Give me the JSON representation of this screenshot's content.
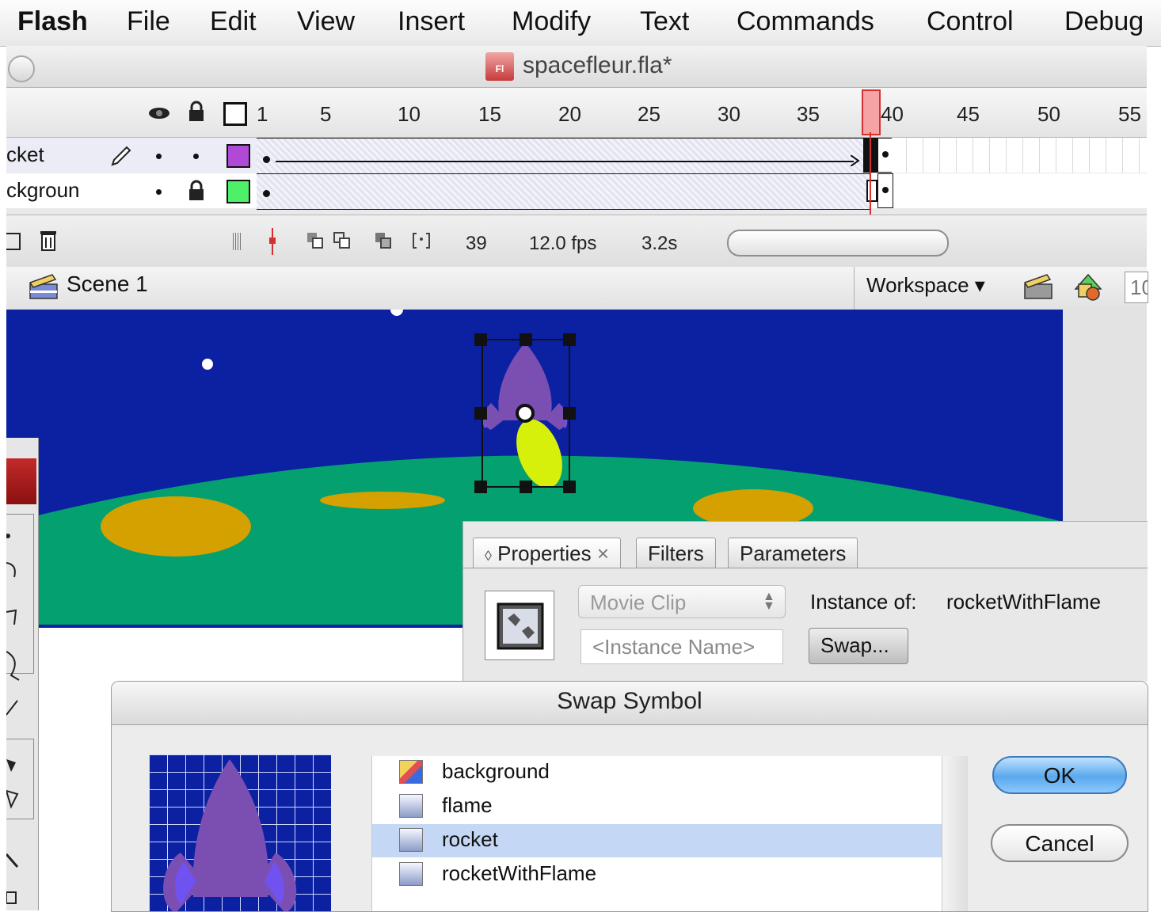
{
  "menubar": {
    "items": [
      "Flash",
      "File",
      "Edit",
      "View",
      "Insert",
      "Modify",
      "Text",
      "Commands",
      "Control",
      "Debug"
    ]
  },
  "window": {
    "title": "spacefleur.fla*",
    "file_icon_text": "Fl"
  },
  "timeline": {
    "ruler_numbers": [
      "1",
      "5",
      "10",
      "15",
      "20",
      "25",
      "30",
      "35",
      "40",
      "45",
      "50",
      "55"
    ],
    "playhead_frame": 39,
    "layers": [
      {
        "name": "cket",
        "swatch_color": "#b04ad6",
        "locked": false
      },
      {
        "name": "ckgroun",
        "swatch_color": "#4ef06a",
        "locked": true
      }
    ],
    "current_frame": "39",
    "fps": "12.0 fps",
    "elapsed": "3.2s"
  },
  "scene_bar": {
    "scene_label": "Scene 1",
    "workspace_label": "Workspace ▾",
    "zoom_partial": "10"
  },
  "stage": {
    "sky_color": "#0b21a2",
    "ground_color": "#05a06f",
    "crater_color": "#d4a100",
    "rocket_color": "#7b4fb2",
    "fin_color": "#6f52f0",
    "flame_color": "#d6f00c"
  },
  "properties": {
    "tabs": [
      "Properties",
      "Filters",
      "Parameters"
    ],
    "symbol_type": "Movie Clip",
    "instance_name_placeholder": "<Instance Name>",
    "instance_of_label": "Instance of:",
    "instance_of_value": "rocketWithFlame",
    "swap_label": "Swap..."
  },
  "swap_dialog": {
    "title": "Swap Symbol",
    "symbols": [
      {
        "name": "background",
        "selected": false
      },
      {
        "name": "flame",
        "selected": false
      },
      {
        "name": "rocket",
        "selected": true
      },
      {
        "name": "rocketWithFlame",
        "selected": false
      }
    ],
    "ok_label": "OK",
    "cancel_label": "Cancel"
  }
}
